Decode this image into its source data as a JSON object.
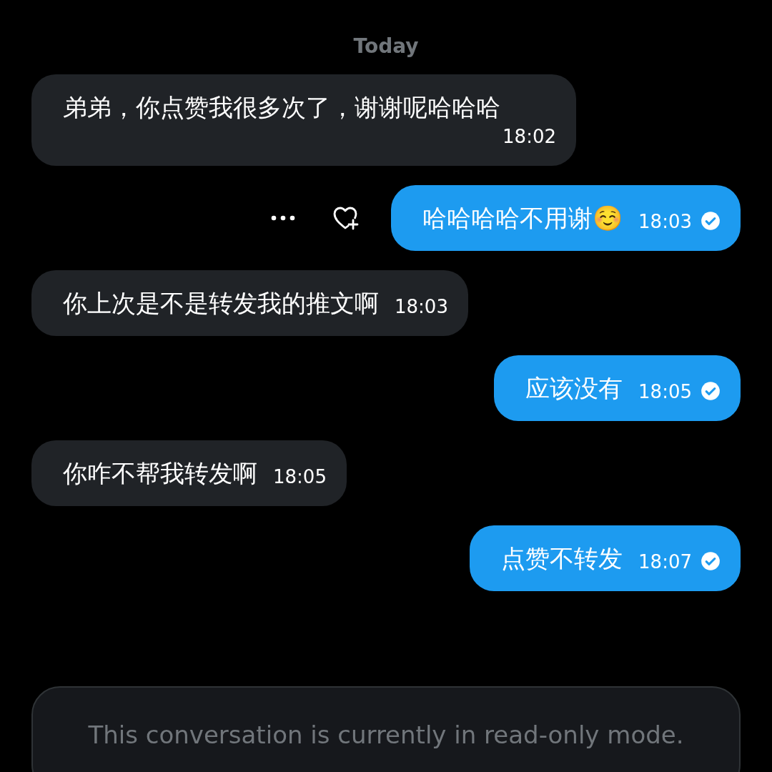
{
  "date_divider": "Today",
  "messages": [
    {
      "kind": "in",
      "text": "弟弟，你点赞我很多次了，谢谢呢哈哈哈",
      "time": "18:02"
    },
    {
      "kind": "out",
      "text": "哈哈哈哈不用谢☺️",
      "time": "18:03",
      "read": true,
      "show_actions": true
    },
    {
      "kind": "in",
      "text": "你上次是不是转发我的推文啊",
      "time": "18:03"
    },
    {
      "kind": "out",
      "text": "应该没有",
      "time": "18:05",
      "read": true,
      "show_actions": false
    },
    {
      "kind": "in",
      "text": "你咋不帮我转发啊",
      "time": "18:05"
    },
    {
      "kind": "out",
      "text": "点赞不转发",
      "time": "18:07",
      "read": true,
      "show_actions": false
    }
  ],
  "composer": {
    "notice": "This conversation is currently in read-only mode."
  }
}
